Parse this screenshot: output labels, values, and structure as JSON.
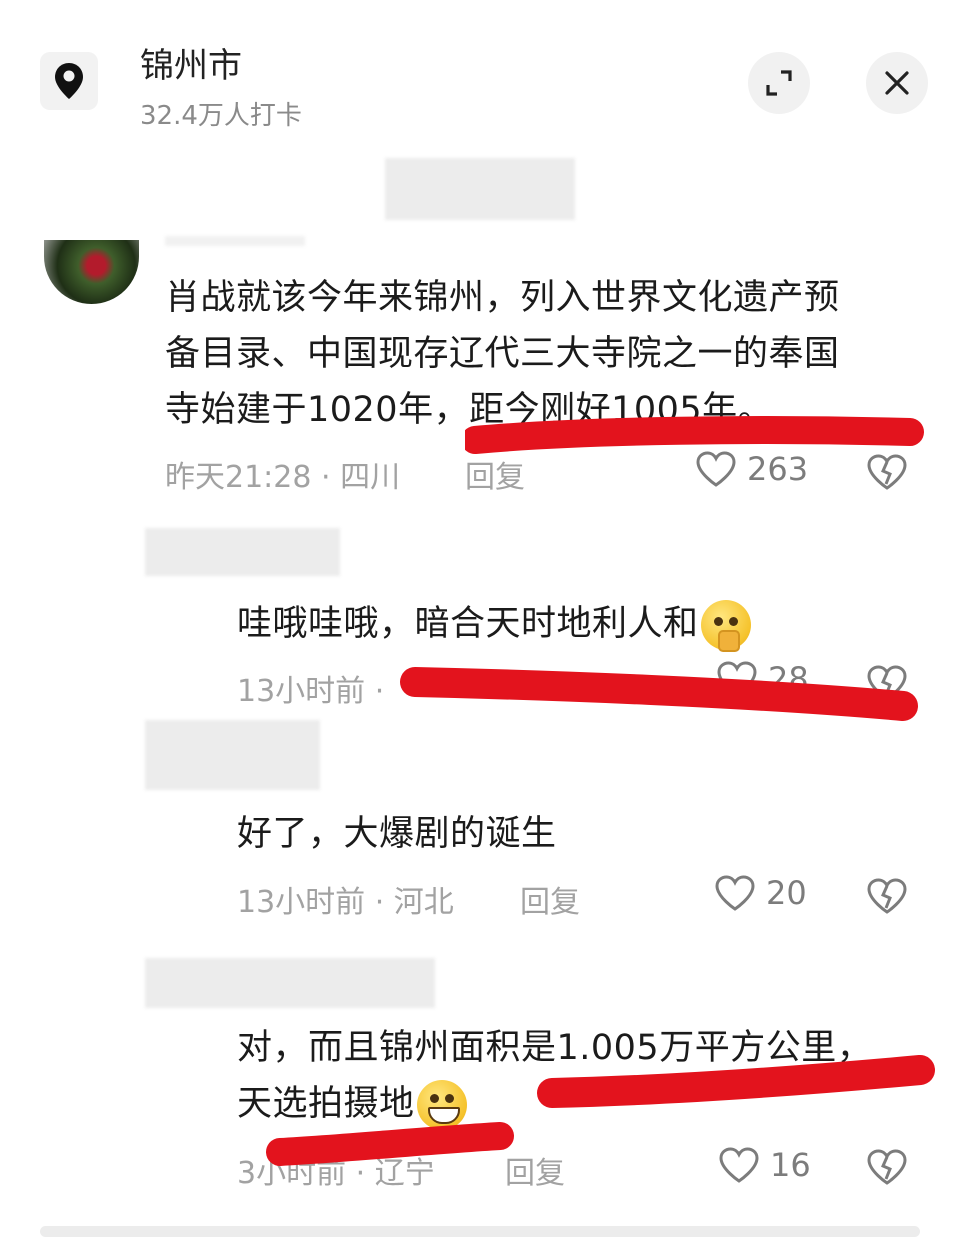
{
  "header": {
    "title": "锦州市",
    "subtitle": "32.4万人打卡"
  },
  "comments": [
    {
      "text": "肖战就该今年来锦州，列入世界文化遗产预备目录、中国现存辽代三大寺院之一的奉国寺始建于1020年，距今刚好1005年。",
      "lines": [
        "肖战就该今年来锦州，列入世界文化遗产预",
        "备目录、中国现存辽代三大寺院之一的奉国",
        "寺始建于1020年，距今刚好1005年。"
      ],
      "time": "昨天21:28 · 四川",
      "reply": "回复",
      "likes": "263"
    },
    {
      "text": "哇哦哇哦，暗合天时地利人和",
      "time": "13小时前 ·",
      "likes": "28"
    },
    {
      "text": "好了，大爆剧的诞生",
      "time": "13小时前 · 河北",
      "reply": "回复",
      "likes": "20"
    },
    {
      "text": "对，而且锦州面积是1.005万平方公里，天选拍摄地",
      "lines": [
        "对，而且锦州面积是1.005万平方公里，",
        "天选拍摄地"
      ],
      "time": "3小时前 · 辽宁",
      "reply": "回复",
      "likes": "16"
    }
  ],
  "icons": {
    "location": "location-pin-icon",
    "expand": "expand-icon",
    "close": "close-icon",
    "like": "heart-outline-icon",
    "dislike": "broken-heart-icon",
    "emoji_shy": "shy-face-emoji-icon",
    "emoji_grin": "grinning-face-emoji-icon"
  },
  "colors": {
    "annotation": "#e3131d",
    "meta_text": "#a2a2a2",
    "body_text": "#1b1b1b"
  }
}
